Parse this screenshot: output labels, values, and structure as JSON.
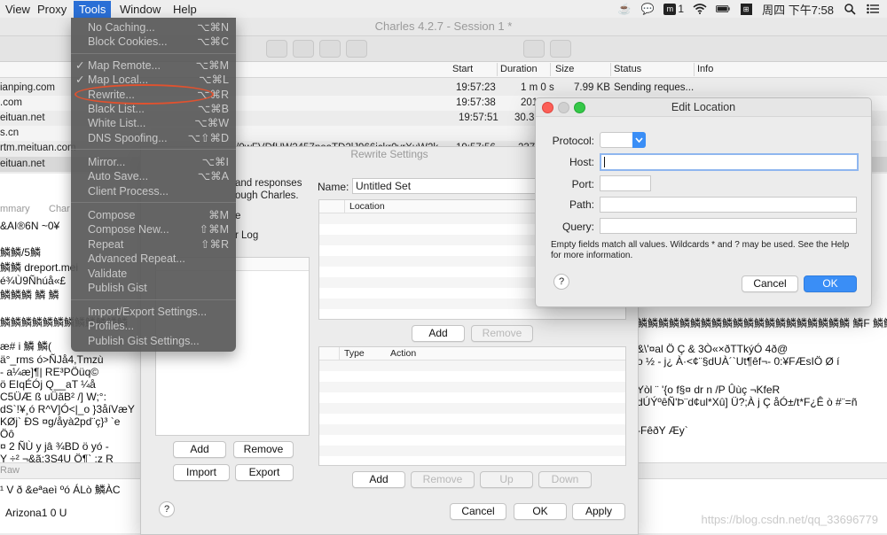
{
  "menubar": {
    "items": [
      "View",
      "Proxy",
      "Tools",
      "Window",
      "Help"
    ],
    "active": "Tools",
    "tray": {
      "badge_count": "1",
      "clock": "周四 下午7:58"
    }
  },
  "window": {
    "title": "Charles 4.2.7 - Session 1 *"
  },
  "table": {
    "columns": {
      "start": "Start",
      "duration": "Duration",
      "size": "Size",
      "status": "Status",
      "info": "Info"
    },
    "rows": [
      {
        "host": "ianping.com",
        "start": "19:57:23",
        "duration": "1 m 0 s",
        "size": "7.99 KB",
        "status": "Sending reques..."
      },
      {
        "host": ".com",
        "start": "19:57:38",
        "duration": "201",
        "size": "",
        "status": ""
      },
      {
        "host": "eituan.net",
        "start": "19:57:51",
        "duration": "30.3",
        "size": "",
        "status": ""
      },
      {
        "host": "s.cn",
        "start": "",
        "duration": "",
        "size": "",
        "status": ""
      },
      {
        "host": "rtm.meituan.com",
        "path": "/0wFVDfHW2457noaTD2lJ966ickr0vrXuW2k...",
        "start": "19:57:56",
        "duration": "237",
        "size": "",
        "status": ""
      },
      {
        "host": "eituan.net",
        "start": "",
        "duration": "",
        "size": "",
        "status": ""
      }
    ]
  },
  "lower": {
    "tab_summary": "mmary",
    "tab_chart": "Char",
    "tab_raw": "Raw",
    "garble_lines": [
      "&AI®6N   ~0¥",
      "",
      "鱗鱗/5鱗",
      "鱗鱗 dreport.mei",
      "é¾Ù9Ñhúå«£",
      "鱗鱗鱗 鱗 鱗",
      "",
      "鱗鱗鱗鱗鱗鱗鱗鱗鱗鱗鱗鱗",
      "",
      "æ# i     鱗  鱗(",
      "ä°_rms   ó>ÑJå4,Tmzù",
      "- a¼æ]¶| RE³PÖüq©",
      "ö   EIqÉÓj          Q__aT ¼å",
      "C5ÜÆ ß         uÜãB² /]   W;°:",
      "dS`!¥¸ó R^V]Ó<|_o }3åíVæY",
      "KØj`   ÐS    ¤g/åyà2pd¨ç}³   `e",
      "Öô",
      "¤   2 ÑÙ y jâ ¾BD       ö   yó -",
      "Y ÷² ¬&ã:3S4U   Ö¶` :z      R"
    ],
    "bottom_line": "Arizona1 0   U",
    "bottom_prefix": "¹   V   ð &eªaeì ºó   ÁLò   鱗ÀC",
    "right_garble_lines": [
      "鱗鱗鱗鱗鱗鱗鱗鱗鱗鱗鱗鱗鱗鱗鱗鱗鱗鱗鱗鱗  鱗F 鱗鱗BA N",
      "&\\'¤al Ö Ç &    3Ò«×ðTTkýÓ  4ð@",
      "o   ½   -    j¿ À·<¢¨§dUÀ´`Ut¶êf¬-   0:¥FÆsIÖ Ø í",
      "Yòl   ¨ '{o  f§¤   dr   n      /P   Ûùç    ¬KfeR",
      "dÚÝºêÑ'Þ¨d¢ul*Xû]   Ü?;À j  Ç   åÓ±/t*F¿Ê ò     #¨=ñ",
      "-FêðY Æy`"
    ]
  },
  "tools_menu": {
    "items": [
      {
        "label": "No Caching...",
        "shortcut": "⌥⌘N"
      },
      {
        "label": "Block Cookies...",
        "shortcut": "⌥⌘C"
      },
      {
        "label": "Map Remote...",
        "shortcut": "⌥⌘M",
        "checked": "✓"
      },
      {
        "label": "Map Local...",
        "shortcut": "⌥⌘L",
        "checked": "✓"
      },
      {
        "label": "Rewrite...",
        "shortcut": "⌥⌘R"
      },
      {
        "label": "Black List...",
        "shortcut": "⌥⌘B"
      },
      {
        "label": "White List...",
        "shortcut": "⌥⌘W"
      },
      {
        "label": "DNS Spoofing...",
        "shortcut": "⌥⇧⌘D"
      },
      {
        "label": "Mirror...",
        "shortcut": "⌥⌘I"
      },
      {
        "label": "Auto Save...",
        "shortcut": "⌥⌘A"
      },
      {
        "label": "Client Process..."
      },
      {
        "label": "Compose",
        "shortcut": "⌘M"
      },
      {
        "label": "Compose New...",
        "shortcut": "⇧⌘M"
      },
      {
        "label": "Repeat",
        "shortcut": "⇧⌘R"
      },
      {
        "label": "Advanced Repeat..."
      },
      {
        "label": "Validate"
      },
      {
        "label": "Publish Gist"
      },
      {
        "label": "Import/Export Settings..."
      },
      {
        "label": "Profiles..."
      },
      {
        "label": "Publish Gist Settings..."
      }
    ]
  },
  "rewrite": {
    "title": "Rewrite Settings",
    "desc_line1": "and responses",
    "desc_line2": "ough Charles.",
    "desc_line3": "e",
    "desc_line4": "r Log",
    "name_label": "Name:",
    "name_value": "Untitled Set",
    "location_header": "Location",
    "type_header": "Type",
    "action_header": "Action",
    "sets_add": "Add",
    "sets_remove": "Remove",
    "import": "Import",
    "export": "Export",
    "loc_add": "Add",
    "loc_remove": "Remove",
    "rules_add": "Add",
    "rules_remove": "Remove",
    "rules_up": "Up",
    "rules_down": "Down",
    "help": "?",
    "cancel": "Cancel",
    "ok": "OK",
    "apply": "Apply"
  },
  "edit_location": {
    "title": "Edit Location",
    "protocol_label": "Protocol:",
    "host_label": "Host:",
    "port_label": "Port:",
    "path_label": "Path:",
    "query_label": "Query:",
    "hint": "Empty fields match all values. Wildcards * and ? may be used. See the Help for more information.",
    "help": "?",
    "cancel": "Cancel",
    "ok": "OK"
  },
  "watermark": "https://blog.csdn.net/qq_33696779"
}
